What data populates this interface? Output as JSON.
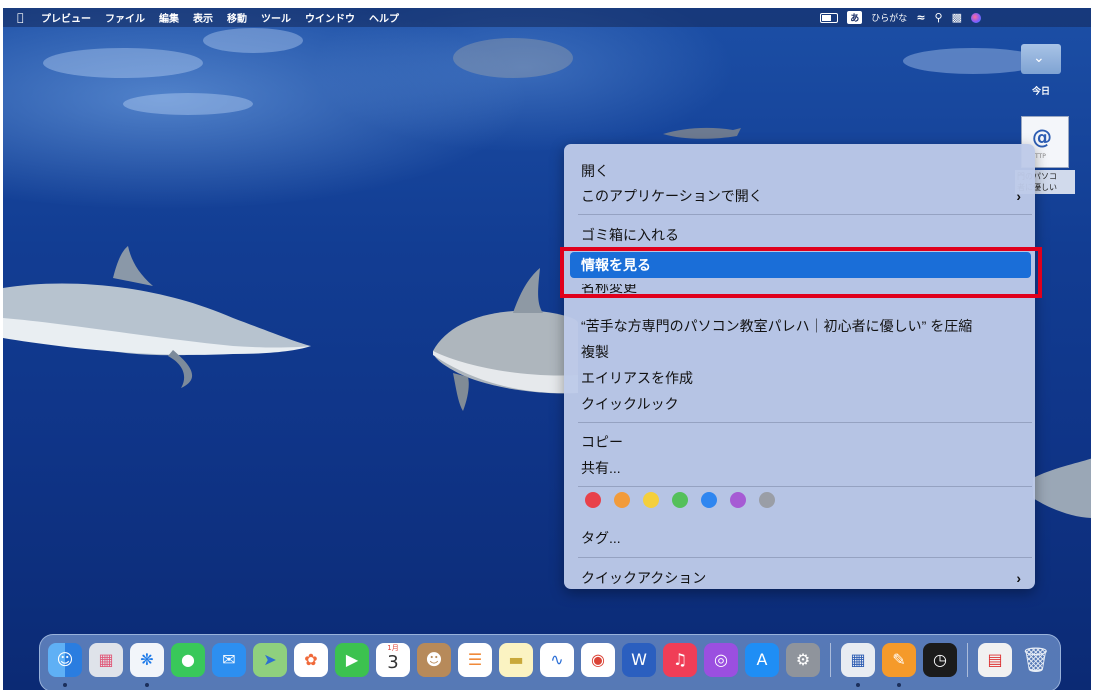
{
  "menubar": {
    "apple_symbol": "",
    "items": [
      "プレビュー",
      "ファイル",
      "編集",
      "表示",
      "移動",
      "ツール",
      "ウインドウ",
      "ヘルプ"
    ],
    "ime_mark": "あ",
    "ime_label": "ひらがな",
    "icons": [
      "battery-icon",
      "wifi-icon",
      "search-icon",
      "control-center-icon",
      "siri-icon"
    ]
  },
  "desktop": {
    "folder_label": "今日",
    "file_label_line1": "門のパソコ",
    "file_label_line2": "者に優しい",
    "file_tag": "TTP"
  },
  "context_menu": {
    "open": "開く",
    "open_with": "このアプリケーションで開く",
    "trash": "ゴミ箱に入れる",
    "get_info": "情報を見る",
    "rename_partial": "名称変更",
    "compress": "“苦手な方専門のパソコン教室パレハ｜初心者に優しい” を圧縮",
    "duplicate": "複製",
    "make_alias": "エイリアスを作成",
    "quick_look": "クイックルック",
    "copy": "コピー",
    "share": "共有...",
    "tags_label": "タグ...",
    "quick_actions": "クイックアクション",
    "submenu_arrow": "›",
    "tag_colors": [
      "#e8414a",
      "#f29b3a",
      "#f4cf3c",
      "#54c05a",
      "#2f86f0",
      "#a65bd4",
      "#9a9ea6"
    ]
  },
  "dock": {
    "calendar_month": "1月",
    "calendar_day": "3",
    "apps": [
      "finder",
      "launchpad",
      "safari",
      "messages",
      "mail",
      "maps",
      "photos",
      "facetime",
      "calendar",
      "contacts",
      "reminders",
      "notes",
      "freeform",
      "chrome",
      "word",
      "music",
      "podcasts",
      "app-store",
      "system-preferences",
      "preview",
      "pages",
      "clock",
      "screenshot",
      "trash"
    ]
  },
  "colors": {
    "highlight": "#1a6ed8",
    "annotation_box": "#e0001c"
  }
}
